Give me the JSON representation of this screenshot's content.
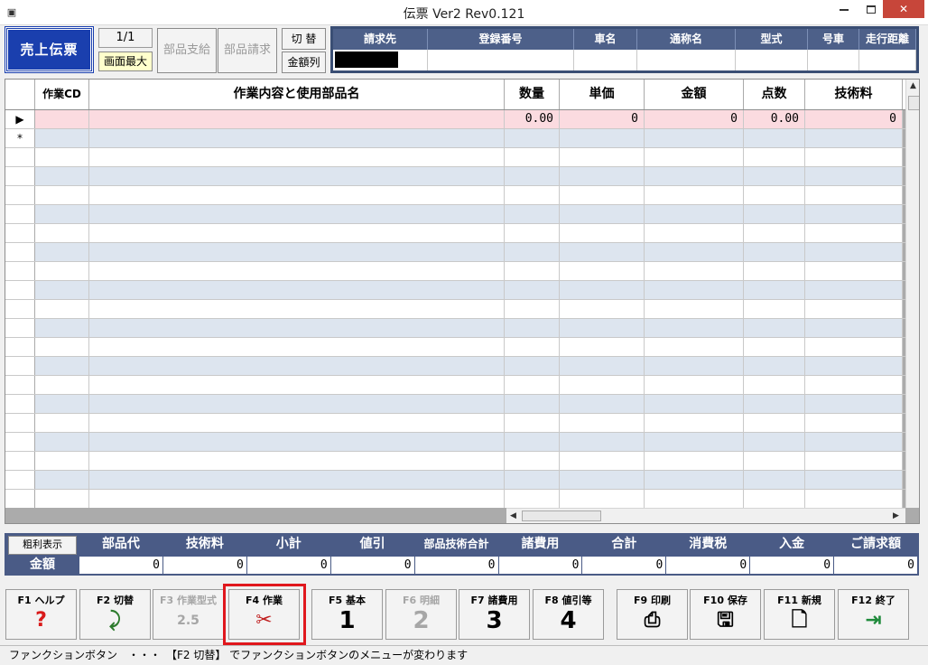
{
  "window": {
    "title": "伝票 Ver2 Rev0.121",
    "minimize": "",
    "maximize": "",
    "close": "✕"
  },
  "toolbar": {
    "sales_slip": "売上伝票",
    "page_indicator": "1/1",
    "maximize_screen": "画面最大",
    "parts_supply": "部品支給",
    "parts_billing": "部品請求",
    "switch": "切 替",
    "amount_columns": "金額列"
  },
  "customer": {
    "headers": [
      "請求先",
      "登録番号",
      "車名",
      "通称名",
      "型式",
      "号車",
      "走行距離"
    ]
  },
  "grid": {
    "headers": [
      "作業CD",
      "作業内容と使用部品名",
      "数量",
      "単価",
      "金額",
      "点数",
      "技術料"
    ],
    "current_row_marker": "▶",
    "new_row_marker": "*",
    "first_row": {
      "quantity": "0.00",
      "unit_price": "0",
      "amount": "0",
      "points": "0.00",
      "tech_fee": "0"
    }
  },
  "totals": {
    "margin_button": "粗利表示",
    "row_label": "金額",
    "headers": [
      "部品代",
      "技術料",
      "小計",
      "値引",
      "部品技術合計",
      "諸費用",
      "合計",
      "消費税",
      "入金",
      "ご請求額"
    ],
    "values": [
      "0",
      "0",
      "0",
      "0",
      "0",
      "0",
      "0",
      "0",
      "0",
      "0"
    ]
  },
  "function_keys": [
    {
      "label": "F1 ヘルプ",
      "icon": "help-icon",
      "glyph": "?"
    },
    {
      "label": "F2 切替",
      "icon": "switch-icon",
      "glyph": "⤸"
    },
    {
      "label": "F3 作業型式",
      "icon": "work-type-icon",
      "glyph": "2.5"
    },
    {
      "label": "F4 作業",
      "icon": "tools-icon",
      "glyph": "✂"
    },
    {
      "label": "F5 基本",
      "icon": "number-1-icon",
      "glyph": "1"
    },
    {
      "label": "F6 明細",
      "icon": "number-2-icon",
      "glyph": "2"
    },
    {
      "label": "F7 諸費用",
      "icon": "number-3-icon",
      "glyph": "3"
    },
    {
      "label": "F8 値引等",
      "icon": "number-4-icon",
      "glyph": "4"
    },
    {
      "label": "F9 印刷",
      "icon": "printer-icon",
      "glyph": "⎙"
    },
    {
      "label": "F10 保存",
      "icon": "floppy-icon",
      "glyph": "🖫"
    },
    {
      "label": "F11 新規",
      "icon": "new-document-icon",
      "glyph": "🗋"
    },
    {
      "label": "F12 終了",
      "icon": "exit-icon",
      "glyph": "⇥"
    }
  ],
  "status": {
    "text": "ファンクションボタン　・・・　【F2 切替】 でファンクションボタンのメニューが変わります"
  }
}
